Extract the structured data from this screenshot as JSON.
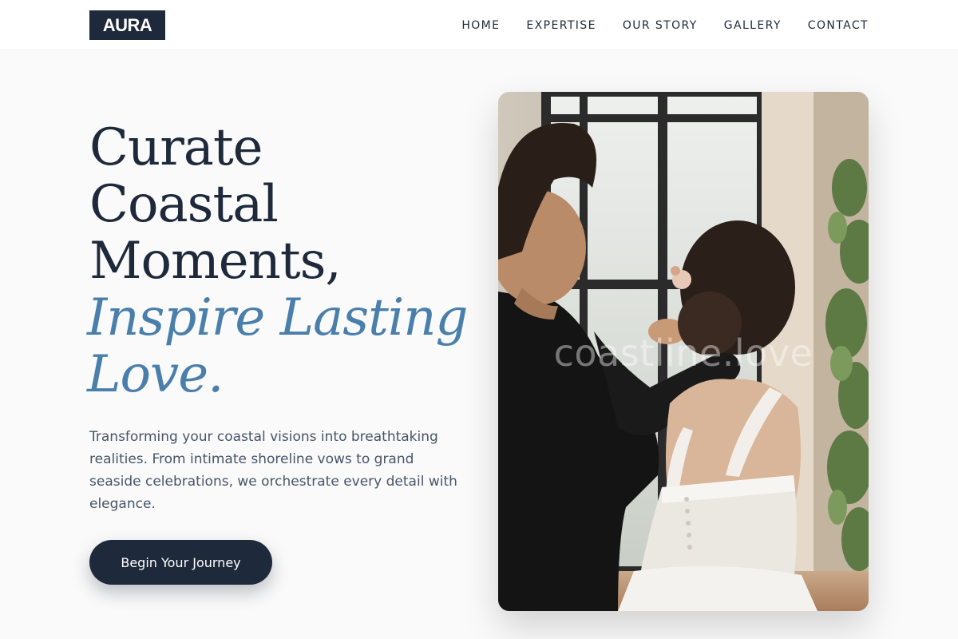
{
  "header": {
    "logo": "AURA",
    "nav": [
      "HOME",
      "EXPERTISE",
      "OUR STORY",
      "GALLERY",
      "CONTACT"
    ]
  },
  "hero": {
    "headline_lines": [
      "Curate",
      "Coastal",
      "Moments,"
    ],
    "headline_accent_lines": [
      "Inspire Lasting",
      "Love."
    ],
    "description": "Transforming your coastal visions into breathtaking realities. From intimate shoreline vows to grand seaside celebrations, we orchestrate every detail with elegance.",
    "cta_label": "Begin Your Journey"
  },
  "image": {
    "watermark": "coastline.love"
  },
  "colors": {
    "navy": "#1e293b",
    "accent_blue": "#4a7fab",
    "body_text": "#475569",
    "background": "#fafafa"
  }
}
